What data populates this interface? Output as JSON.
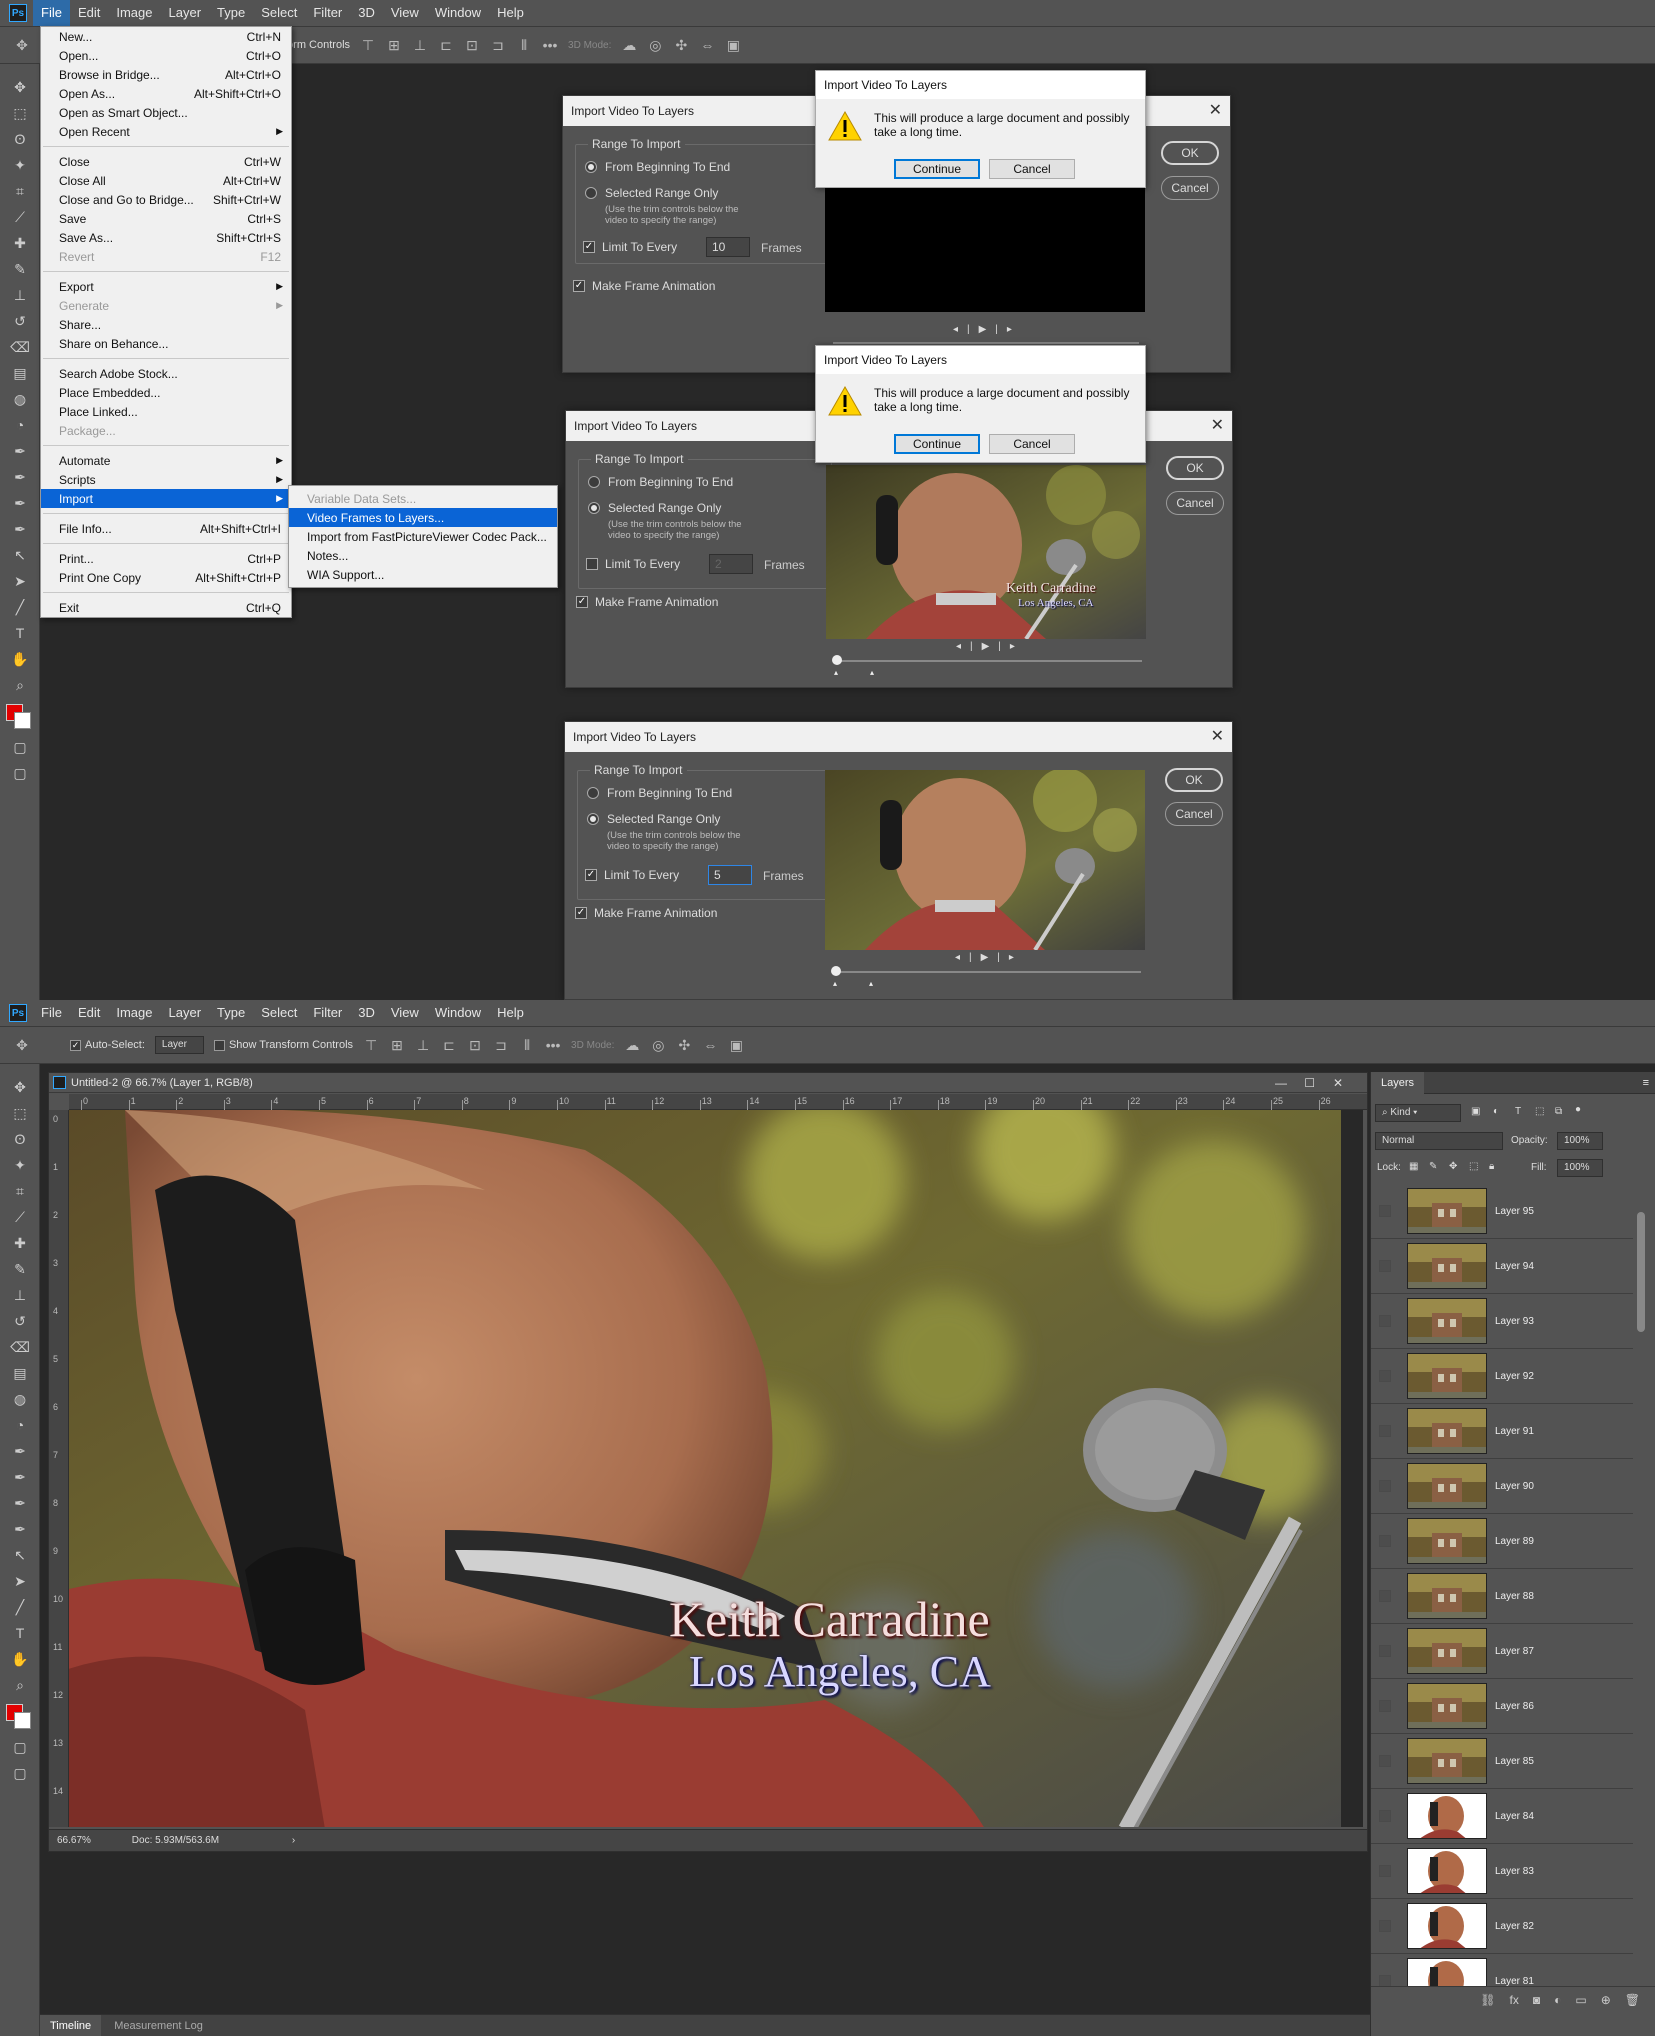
{
  "menubar": [
    "File",
    "Edit",
    "Image",
    "Layer",
    "Type",
    "Select",
    "Filter",
    "3D",
    "View",
    "Window",
    "Help"
  ],
  "ps_logo": "Ps",
  "top_options": {
    "transform_partial": "form Controls",
    "mode_label": "3D Mode:"
  },
  "bottom_options": {
    "auto_select_label": "Auto-Select:",
    "auto_select_value": "Layer",
    "show_transform": "Show Transform Controls",
    "mode_label": "3D Mode:"
  },
  "file_menu": [
    {
      "label": "New...",
      "shortcut": "Ctrl+N"
    },
    {
      "label": "Open...",
      "shortcut": "Ctrl+O"
    },
    {
      "label": "Browse in Bridge...",
      "shortcut": "Alt+Ctrl+O"
    },
    {
      "label": "Open As...",
      "shortcut": "Alt+Shift+Ctrl+O"
    },
    {
      "label": "Open as Smart Object...",
      "shortcut": ""
    },
    {
      "label": "Open Recent",
      "shortcut": "",
      "submenu": true
    },
    {
      "sep": true
    },
    {
      "label": "Close",
      "shortcut": "Ctrl+W"
    },
    {
      "label": "Close All",
      "shortcut": "Alt+Ctrl+W"
    },
    {
      "label": "Close and Go to Bridge...",
      "shortcut": "Shift+Ctrl+W"
    },
    {
      "label": "Save",
      "shortcut": "Ctrl+S"
    },
    {
      "label": "Save As...",
      "shortcut": "Shift+Ctrl+S"
    },
    {
      "label": "Revert",
      "shortcut": "F12",
      "disabled": true
    },
    {
      "sep": true
    },
    {
      "label": "Export",
      "shortcut": "",
      "submenu": true
    },
    {
      "label": "Generate",
      "shortcut": "",
      "submenu": true,
      "disabled": true
    },
    {
      "label": "Share...",
      "shortcut": ""
    },
    {
      "label": "Share on Behance...",
      "shortcut": ""
    },
    {
      "sep": true
    },
    {
      "label": "Search Adobe Stock...",
      "shortcut": ""
    },
    {
      "label": "Place Embedded...",
      "shortcut": ""
    },
    {
      "label": "Place Linked...",
      "shortcut": ""
    },
    {
      "label": "Package...",
      "shortcut": "",
      "disabled": true
    },
    {
      "sep": true
    },
    {
      "label": "Automate",
      "shortcut": "",
      "submenu": true
    },
    {
      "label": "Scripts",
      "shortcut": "",
      "submenu": true
    },
    {
      "label": "Import",
      "shortcut": "",
      "submenu": true,
      "highlight": true
    },
    {
      "sep": true
    },
    {
      "label": "File Info...",
      "shortcut": "Alt+Shift+Ctrl+I"
    },
    {
      "sep": true
    },
    {
      "label": "Print...",
      "shortcut": "Ctrl+P"
    },
    {
      "label": "Print One Copy",
      "shortcut": "Alt+Shift+Ctrl+P"
    },
    {
      "sep": true
    },
    {
      "label": "Exit",
      "shortcut": "Ctrl+Q"
    }
  ],
  "import_submenu": [
    {
      "label": "Variable Data Sets...",
      "disabled": true
    },
    {
      "label": "Video Frames to Layers...",
      "highlight": true
    },
    {
      "label": "Import from FastPictureViewer Codec Pack..."
    },
    {
      "label": "Notes..."
    },
    {
      "label": "WIA Support..."
    }
  ],
  "dialog": {
    "title": "Import Video To Layers",
    "range_label": "Range To Import",
    "opt_all": "From Beginning To End",
    "opt_range": "Selected Range Only",
    "range_note_1": "(Use the trim controls below the",
    "range_note_2": "video to specify the range)",
    "limit_label": "Limit To Every",
    "frames_label": "Frames",
    "anim_label": "Make Frame Animation",
    "ok": "OK",
    "cancel": "Cancel",
    "close": "✕",
    "controls": "◂|▶|▸",
    "d1_limit": "10",
    "d2_limit": "2",
    "d3_limit": "5"
  },
  "alert": {
    "title": "Import Video To Layers",
    "message": "This will produce a large document and possibly take a long time.",
    "continue": "Continue",
    "cancel": "Cancel"
  },
  "video_overlay": {
    "line1": "Keith Carradine",
    "line2": "Los Angeles, CA"
  },
  "document": {
    "tab_title": "Untitled-2 @ 66.7% (Layer 1, RGB/8)",
    "zoom": "66.67%",
    "doc_size": "Doc: 5.93M/563.6M",
    "ruler_h": [
      "0",
      "1",
      "2",
      "3",
      "4",
      "5",
      "6",
      "7",
      "8",
      "9",
      "10",
      "11",
      "12",
      "13",
      "14",
      "15",
      "16",
      "17",
      "18",
      "19",
      "20",
      "21",
      "22",
      "23",
      "24",
      "25",
      "26"
    ],
    "ruler_v": [
      "0",
      "1",
      "2",
      "3",
      "4",
      "5",
      "6",
      "7",
      "8",
      "9",
      "10",
      "11",
      "12",
      "13",
      "14"
    ]
  },
  "layers_panel": {
    "tab": "Layers",
    "kind": "Kind",
    "blend": "Normal",
    "opacity_label": "Opacity:",
    "opacity": "100%",
    "lock_label": "Lock:",
    "fill_label": "Fill:",
    "fill": "100%",
    "layers": [
      "Layer 95",
      "Layer 94",
      "Layer 93",
      "Layer 92",
      "Layer 91",
      "Layer 90",
      "Layer 89",
      "Layer 88",
      "Layer 87",
      "Layer 86",
      "Layer 85",
      "Layer 84",
      "Layer 83",
      "Layer 82",
      "Layer 81"
    ]
  },
  "timeline_tabs": [
    "Timeline",
    "Measurement Log"
  ],
  "colors": {
    "foreground": "#e20000",
    "background": "#ffffff",
    "accent": "#0a64d6"
  }
}
